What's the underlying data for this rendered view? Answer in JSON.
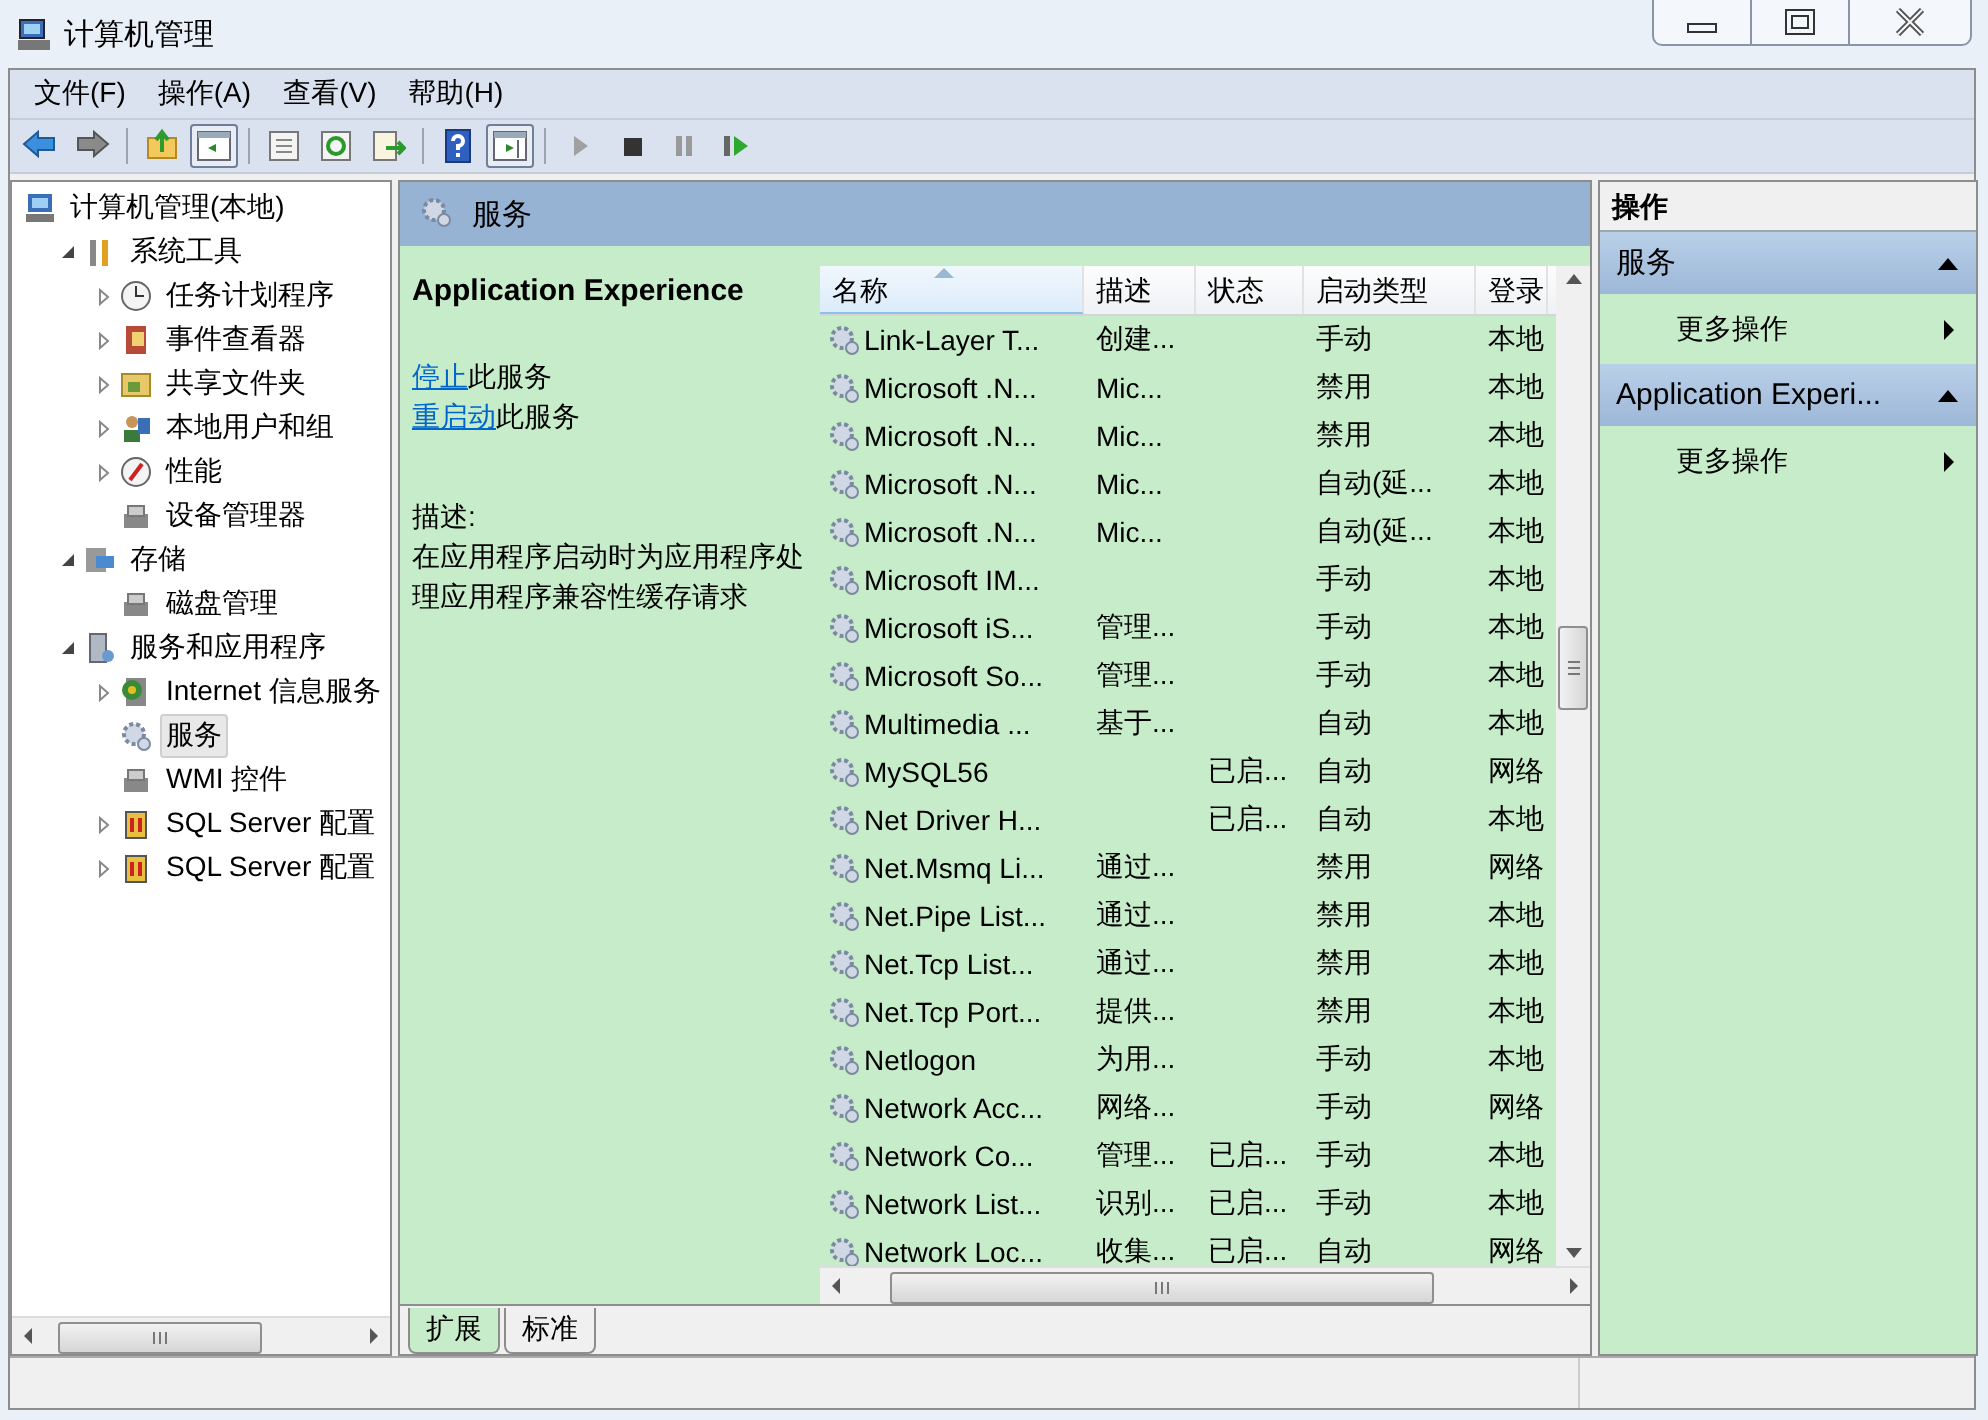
{
  "window": {
    "title": "计算机管理"
  },
  "menu": [
    "文件(F)",
    "操作(A)",
    "查看(V)",
    "帮助(H)"
  ],
  "toolbar": [
    {
      "kind": "back",
      "pressed": false
    },
    {
      "kind": "forward",
      "pressed": false
    },
    {
      "kind": "sep"
    },
    {
      "kind": "up",
      "pressed": false
    },
    {
      "kind": "tree",
      "pressed": true
    },
    {
      "kind": "sep"
    },
    {
      "kind": "props",
      "pressed": false
    },
    {
      "kind": "refresh",
      "pressed": false
    },
    {
      "kind": "export",
      "pressed": false
    },
    {
      "kind": "sep"
    },
    {
      "kind": "help",
      "pressed": false
    },
    {
      "kind": "pane",
      "pressed": true
    },
    {
      "kind": "sep"
    },
    {
      "kind": "play",
      "pressed": false
    },
    {
      "kind": "stop",
      "pressed": false
    },
    {
      "kind": "pause",
      "pressed": false
    },
    {
      "kind": "resume",
      "pressed": false
    }
  ],
  "tree": [
    {
      "label": "计算机管理(本地)",
      "kind": "computer",
      "selected": false,
      "children": [
        {
          "label": "系统工具",
          "kind": "tools",
          "expanded": true,
          "selected": false,
          "children": [
            {
              "label": "任务计划程序",
              "kind": "clock",
              "expanded": false,
              "selected": false
            },
            {
              "label": "事件查看器",
              "kind": "book",
              "expanded": false,
              "selected": false
            },
            {
              "label": "共享文件夹",
              "kind": "folder",
              "expanded": false,
              "selected": false
            },
            {
              "label": "本地用户和组",
              "kind": "users",
              "expanded": false,
              "selected": false
            },
            {
              "label": "性能",
              "kind": "gauge",
              "expanded": false,
              "selected": false
            },
            {
              "label": "设备管理器",
              "kind": "device",
              "selected": false
            }
          ]
        },
        {
          "label": "存储",
          "kind": "storage",
          "expanded": true,
          "selected": false,
          "children": [
            {
              "label": "磁盘管理",
              "kind": "device",
              "selected": false
            }
          ]
        },
        {
          "label": "服务和应用程序",
          "kind": "server",
          "expanded": true,
          "selected": false,
          "children": [
            {
              "label": "Internet 信息服务",
              "kind": "globe",
              "expanded": false,
              "selected": false
            },
            {
              "label": "服务",
              "kind": "gear",
              "selected": true
            },
            {
              "label": "WMI 控件",
              "kind": "device",
              "selected": false
            },
            {
              "label": "SQL Server 配置",
              "kind": "sql",
              "expanded": false,
              "selected": false
            },
            {
              "label": "SQL Server 配置",
              "kind": "sql",
              "expanded": false,
              "selected": false
            }
          ]
        }
      ]
    }
  ],
  "center": {
    "title": "服务",
    "details": {
      "service": "Application Experience",
      "actions": [
        {
          "link": "停止",
          "text": "此服务"
        },
        {
          "link": "重启动",
          "text": "此服务"
        }
      ],
      "description_label": "描述:",
      "description": "在应用程序启动时为应用程序处理应用程序兼容性缓存请求"
    },
    "table": {
      "columns": [
        {
          "label": "名称",
          "sorted": true
        },
        {
          "label": "描述",
          "sorted": false
        },
        {
          "label": "状态",
          "sorted": false
        },
        {
          "label": "启动类型",
          "sorted": false
        },
        {
          "label": "登录",
          "sorted": false
        }
      ],
      "rows": [
        {
          "name": "Link-Layer T...",
          "description": "创建...",
          "startup": "手动",
          "logon": "本地"
        },
        {
          "name": "Microsoft .N...",
          "description": "Mic...",
          "startup": "禁用",
          "logon": "本地"
        },
        {
          "name": "Microsoft .N...",
          "description": "Mic...",
          "startup": "禁用",
          "logon": "本地"
        },
        {
          "name": "Microsoft .N...",
          "description": "Mic...",
          "startup": "自动(延...",
          "logon": "本地"
        },
        {
          "name": "Microsoft .N...",
          "description": "Mic...",
          "startup": "自动(延...",
          "logon": "本地"
        },
        {
          "name": "Microsoft IM...",
          "startup": "手动",
          "logon": "本地"
        },
        {
          "name": "Microsoft iS...",
          "description": "管理...",
          "startup": "手动",
          "logon": "本地"
        },
        {
          "name": "Microsoft So...",
          "description": "管理...",
          "startup": "手动",
          "logon": "本地"
        },
        {
          "name": "Multimedia ...",
          "description": "基于...",
          "startup": "自动",
          "logon": "本地"
        },
        {
          "name": "MySQL56",
          "status": "已启...",
          "startup": "自动",
          "logon": "网络"
        },
        {
          "name": "Net Driver H...",
          "status": "已启...",
          "startup": "自动",
          "logon": "本地"
        },
        {
          "name": "Net.Msmq Li...",
          "description": "通过...",
          "startup": "禁用",
          "logon": "网络"
        },
        {
          "name": "Net.Pipe List...",
          "description": "通过...",
          "startup": "禁用",
          "logon": "本地"
        },
        {
          "name": "Net.Tcp List...",
          "description": "通过...",
          "startup": "禁用",
          "logon": "本地"
        },
        {
          "name": "Net.Tcp Port...",
          "description": "提供...",
          "startup": "禁用",
          "logon": "本地"
        },
        {
          "name": "Netlogon",
          "description": "为用...",
          "startup": "手动",
          "logon": "本地"
        },
        {
          "name": "Network Acc...",
          "description": "网络...",
          "startup": "手动",
          "logon": "网络"
        },
        {
          "name": "Network Co...",
          "description": "管理...",
          "status": "已启...",
          "startup": "手动",
          "logon": "本地"
        },
        {
          "name": "Network List...",
          "description": "识别...",
          "status": "已启...",
          "startup": "手动",
          "logon": "本地"
        },
        {
          "name": "Network Loc...",
          "description": "收集...",
          "status": "已启...",
          "startup": "自动",
          "logon": "网络"
        }
      ]
    },
    "tabs": [
      {
        "label": "扩展",
        "selected": true
      },
      {
        "label": "标准",
        "selected": false
      }
    ]
  },
  "actions": {
    "title": "操作",
    "sections": [
      {
        "title": "服务",
        "expanded": true,
        "items": [
          "更多操作"
        ]
      },
      {
        "title": "Application Experi...",
        "expanded": true,
        "items": [
          "更多操作"
        ]
      }
    ]
  }
}
